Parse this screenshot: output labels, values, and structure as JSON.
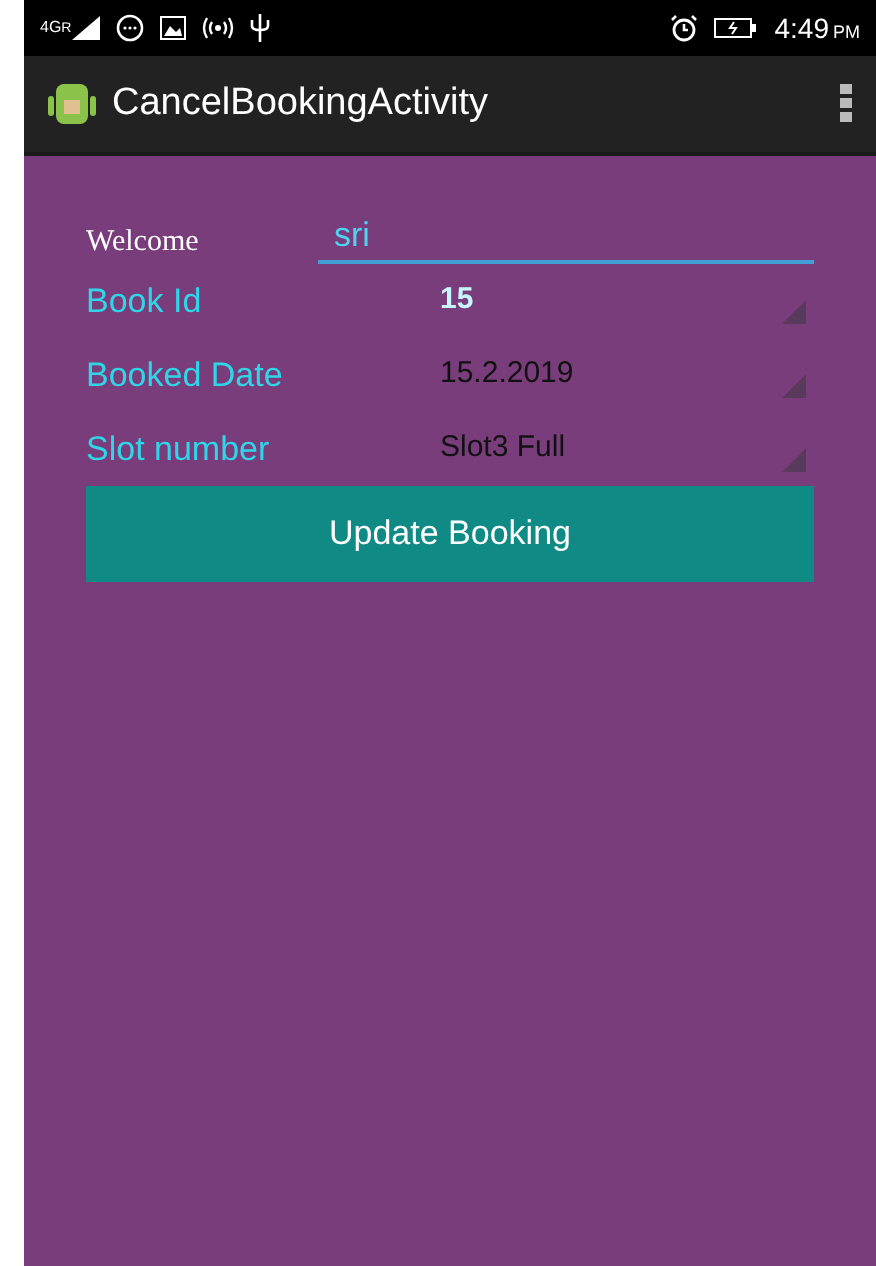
{
  "status_bar": {
    "network": "4G",
    "roaming": "R",
    "time": "4:49",
    "time_suffix": "PM"
  },
  "action_bar": {
    "title": "CancelBookingActivity"
  },
  "welcome": {
    "label": "Welcome",
    "value": "sri"
  },
  "rows": [
    {
      "label": "Book Id",
      "value": "15",
      "emphasis": true
    },
    {
      "label": "Booked Date",
      "value": "15.2.2019",
      "emphasis": false
    },
    {
      "label": "Slot number",
      "value": "Slot3 Full",
      "emphasis": false
    }
  ],
  "button": {
    "label": "Update Booking"
  }
}
